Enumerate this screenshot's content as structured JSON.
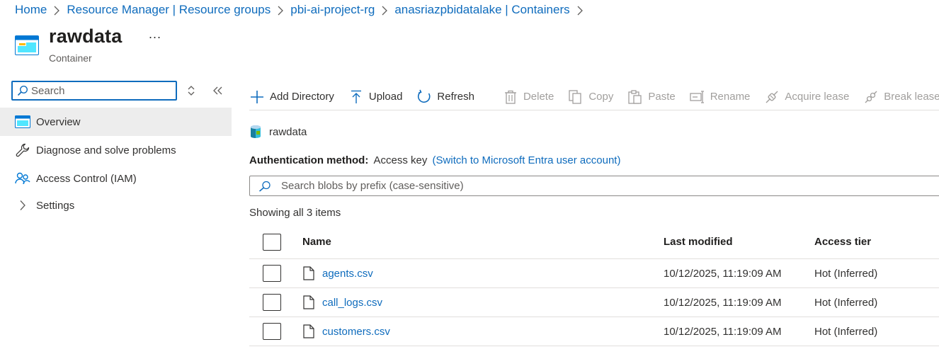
{
  "breadcrumb": [
    "Home",
    "Resource Manager | Resource groups",
    "pbi-ai-project-rg",
    "anasriazpbidatalake | Containers"
  ],
  "header": {
    "title": "rawdata",
    "subtitle": "Container",
    "more_label": "..."
  },
  "nav": {
    "search_placeholder": "Search",
    "items": [
      {
        "label": "Overview",
        "icon": "container-icon"
      },
      {
        "label": "Diagnose and solve problems",
        "icon": "wrench-icon"
      },
      {
        "label": "Access Control (IAM)",
        "icon": "people-icon"
      },
      {
        "label": "Settings",
        "icon": "chevron-right-icon"
      }
    ]
  },
  "toolbar": {
    "add_directory": "Add Directory",
    "upload": "Upload",
    "refresh": "Refresh",
    "delete": "Delete",
    "copy": "Copy",
    "paste": "Paste",
    "rename": "Rename",
    "acquire_lease": "Acquire lease",
    "break_lease": "Break lease"
  },
  "container_name": "rawdata",
  "auth": {
    "label": "Authentication method:",
    "value": "Access key",
    "switch_link": "(Switch to Microsoft Entra user account)"
  },
  "blob_search": {
    "placeholder": "Search blobs by prefix (case-sensitive)"
  },
  "showing": "Showing all 3 items",
  "table": {
    "columns": {
      "name": "Name",
      "modified": "Last modified",
      "tier": "Access tier"
    },
    "rows": [
      {
        "name": "agents.csv",
        "modified": "10/12/2025, 11:19:09 AM",
        "tier": "Hot (Inferred)"
      },
      {
        "name": "call_logs.csv",
        "modified": "10/12/2025, 11:19:09 AM",
        "tier": "Hot (Inferred)"
      },
      {
        "name": "customers.csv",
        "modified": "10/12/2025, 11:19:09 AM",
        "tier": "Hot (Inferred)"
      }
    ]
  },
  "colors": {
    "accent": "#0f6cbd",
    "text": "#323130",
    "disabled": "#a19f9d",
    "nav_active": "#ededed"
  }
}
